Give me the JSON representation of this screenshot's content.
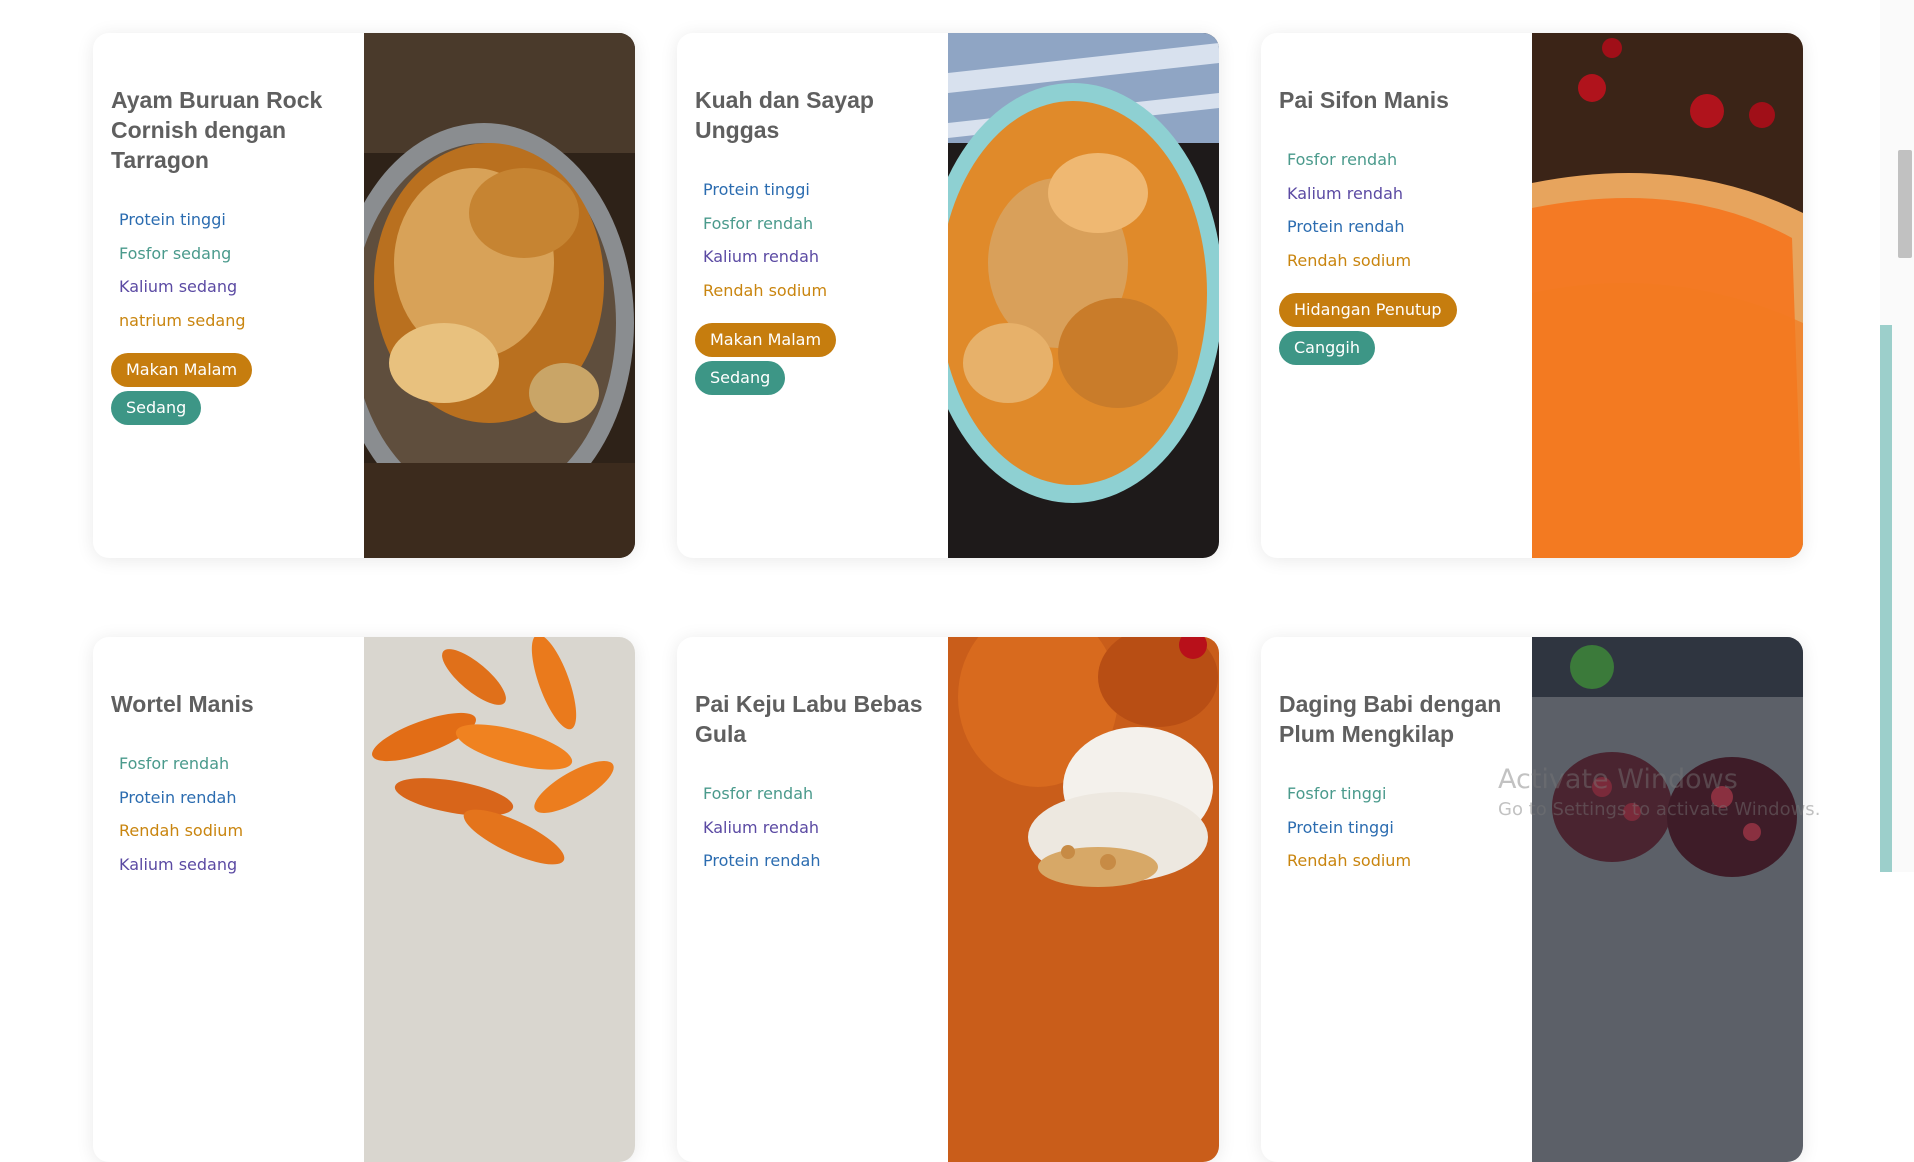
{
  "colors": {
    "protein": "#2b6cb0",
    "fosfor": "#4a9a8c",
    "kalium": "#5b4aa3",
    "natrium": "#c9850f",
    "tag_meal": "#c67d0e",
    "tag_level": "#3d9686"
  },
  "recipes": [
    {
      "title": "Ayam Buruan Rock Cornish dengan Tarragon",
      "nutrients": [
        {
          "text": "Protein tinggi",
          "kind": "protein"
        },
        {
          "text": "Fosfor sedang",
          "kind": "fosfor"
        },
        {
          "text": "Kalium sedang",
          "kind": "kalium"
        },
        {
          "text": "natrium sedang",
          "kind": "natrium"
        }
      ],
      "tags": [
        {
          "text": "Makan Malam"
        },
        {
          "text": "Sedang"
        }
      ],
      "image": "roast-chicken"
    },
    {
      "title": "Kuah dan Sayap Unggas",
      "nutrients": [
        {
          "text": "Protein tinggi",
          "kind": "protein"
        },
        {
          "text": "Fosfor rendah",
          "kind": "fosfor"
        },
        {
          "text": "Kalium rendah",
          "kind": "kalium"
        },
        {
          "text": "Rendah sodium",
          "kind": "natrium"
        }
      ],
      "tags": [
        {
          "text": "Makan Malam"
        },
        {
          "text": "Sedang"
        }
      ],
      "image": "chicken-curry"
    },
    {
      "title": "Pai Sifon Manis",
      "nutrients": [
        {
          "text": "Fosfor rendah",
          "kind": "fosfor"
        },
        {
          "text": "Kalium rendah",
          "kind": "kalium"
        },
        {
          "text": "Protein rendah",
          "kind": "protein"
        },
        {
          "text": "Rendah sodium",
          "kind": "natrium"
        }
      ],
      "tags": [
        {
          "text": "Hidangan Penutup"
        },
        {
          "text": "Canggih"
        }
      ],
      "image": "sweet-pie"
    },
    {
      "title": "Wortel Manis",
      "nutrients": [
        {
          "text": "Fosfor rendah",
          "kind": "fosfor"
        },
        {
          "text": "Protein rendah",
          "kind": "protein"
        },
        {
          "text": "Rendah sodium",
          "kind": "natrium"
        },
        {
          "text": "Kalium sedang",
          "kind": "kalium"
        }
      ],
      "tags": [],
      "image": "glazed-carrots"
    },
    {
      "title": "Pai Keju Labu Bebas Gula",
      "nutrients": [
        {
          "text": "Fosfor rendah",
          "kind": "fosfor"
        },
        {
          "text": "Kalium rendah",
          "kind": "kalium"
        },
        {
          "text": "Protein rendah",
          "kind": "protein"
        }
      ],
      "tags": [],
      "image": "pumpkin-cheesecake"
    },
    {
      "title": "Daging Babi dengan Plum Mengkilap",
      "nutrients": [
        {
          "text": "Fosfor tinggi",
          "kind": "fosfor"
        },
        {
          "text": "Protein tinggi",
          "kind": "protein"
        },
        {
          "text": "Rendah sodium",
          "kind": "natrium"
        }
      ],
      "tags": [],
      "image": "plum-pork"
    }
  ],
  "watermark": {
    "line1": "Activate Windows",
    "line2": "Go to Settings to activate Windows."
  }
}
